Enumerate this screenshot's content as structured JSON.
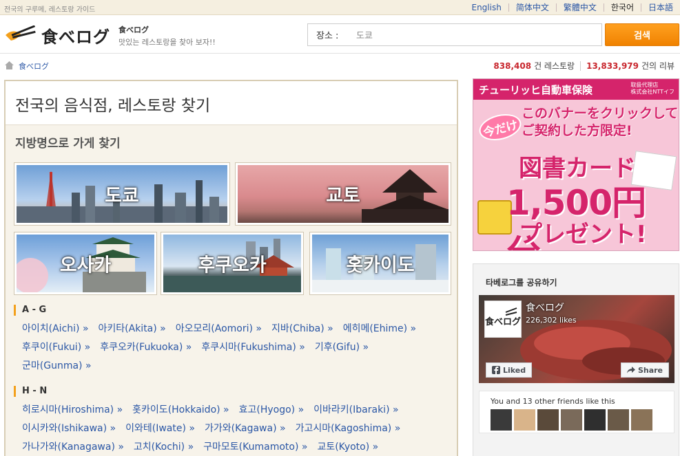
{
  "topbar": {
    "tagline": "전국의 구루메, 레스토랑 가이드",
    "languages": [
      {
        "label": "English",
        "active": false
      },
      {
        "label": "简体中文",
        "active": false
      },
      {
        "label": "繁體中文",
        "active": false
      },
      {
        "label": "한국어",
        "active": true
      },
      {
        "label": "日本語",
        "active": false
      }
    ]
  },
  "header": {
    "logo_text": "食べログ",
    "site_name": "食べログ",
    "site_slogan": "맛있는 레스토랑을 찾아 보자!!",
    "search_label": "장소 :",
    "search_value": "도쿄",
    "search_button": "검색"
  },
  "crumbs": {
    "home": "食べログ",
    "restaurant_count": "838,408",
    "restaurant_suffix": "건 레스토랑",
    "review_count": "13,833,979",
    "review_suffix": "건의 리뷰"
  },
  "main": {
    "title": "전국의 음식점, 레스토랑 찾기",
    "section_title": "지방명으로 가게 찾기",
    "regions": [
      "도쿄",
      "교토",
      "오사카",
      "후쿠오카",
      "홋카이도"
    ],
    "groups": [
      {
        "head": "A - G",
        "rows": [
          [
            "아이치(Aichi) »",
            "아키타(Akita) »",
            "아오모리(Aomori) »",
            "지바(Chiba) »",
            "에히메(Ehime) »"
          ],
          [
            "후쿠이(Fukui) »",
            "후쿠오카(Fukuoka) »",
            "후쿠시마(Fukushima) »",
            "기후(Gifu) »"
          ],
          [
            "군마(Gunma) »"
          ]
        ]
      },
      {
        "head": "H - N",
        "rows": [
          [
            "히로시마(Hiroshima) »",
            "홋카이도(Hokkaido) »",
            "효고(Hyogo) »",
            "이바라키(Ibaraki) »"
          ],
          [
            "이시카와(Ishikawa) »",
            "이와테(Iwate) »",
            "가가와(Kagawa) »",
            "가고시마(Kagoshima) »"
          ],
          [
            "가나가와(Kanagawa) »",
            "고치(Kochi) »",
            "구마모토(Kumamoto) »",
            "교토(Kyoto) »"
          ]
        ]
      }
    ]
  },
  "ad": {
    "top": "チューリッヒ自動車保険",
    "top_small1": "取扱代理店",
    "top_small2": "株式会社NTTイフ",
    "badge": "今だけ",
    "line1": "このバナーをクリックして",
    "line2": "ご契約した方限定!",
    "card": "図書カード",
    "amount": "1,500円分",
    "present": "プレゼント!"
  },
  "share": {
    "title": "타베로그를 공유하기",
    "page_name": "食べログ",
    "likes": "226,302 likes",
    "liked_label": "Liked",
    "share_label": "Share",
    "friends_text": "You and 13 other friends like this"
  },
  "colors": {
    "accent_orange": "#f08200",
    "link_blue": "#2a56a5",
    "count_red": "#c8262d",
    "panel_border": "#d8cdb4"
  }
}
